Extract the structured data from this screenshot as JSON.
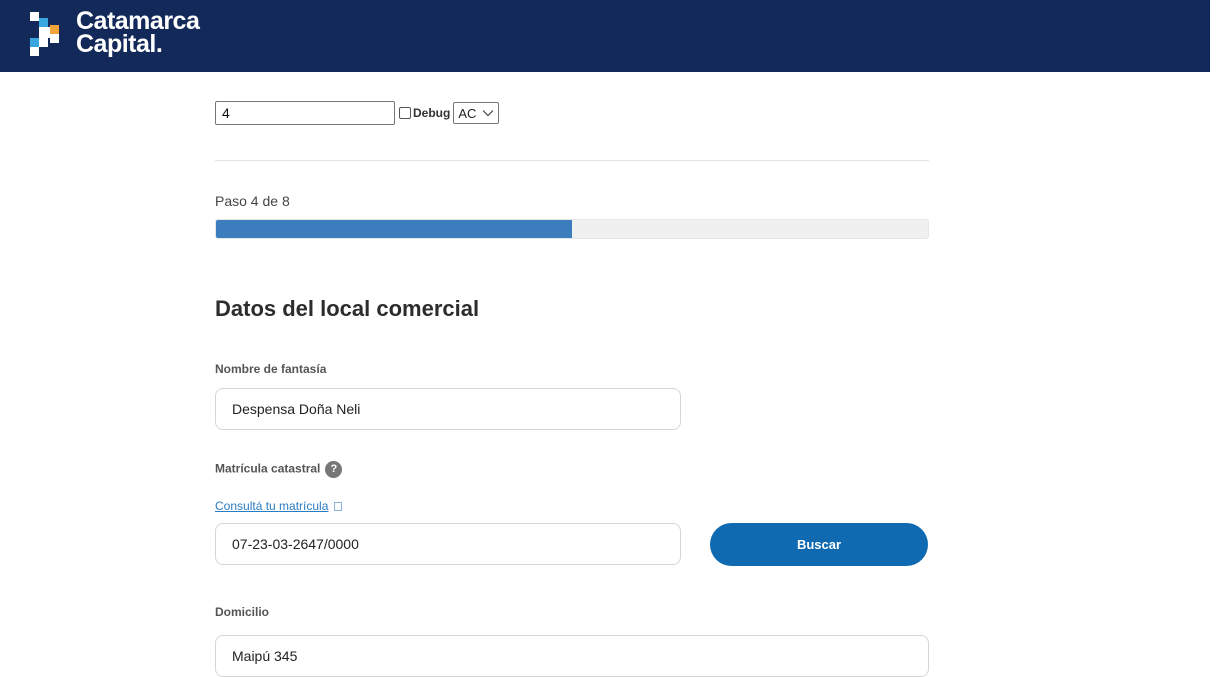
{
  "header": {
    "logo_line1": "Catamarca",
    "logo_line2": "Capital."
  },
  "debug": {
    "input_value": "4",
    "checkbox_label": "Debug",
    "select_value": "AC"
  },
  "progress": {
    "step_text": "Paso 4 de 8",
    "current": 4,
    "total": 8,
    "fill_color": "#3c7dbd"
  },
  "form": {
    "section_title": "Datos del local comercial",
    "fields": {
      "nombre_fantasia": {
        "label": "Nombre de fantasía",
        "value": "Despensa Doña Neli"
      },
      "matricula": {
        "label": "Matrícula catastral",
        "help_icon_glyph": "?",
        "link_text": "Consultá tu matrícula",
        "value": "07-23-03-2647/0000",
        "button_label": "Buscar"
      },
      "domicilio": {
        "label": "Domicilio",
        "value": "Maipú 345"
      }
    }
  },
  "colors": {
    "header_bg": "#13295a",
    "primary_button": "#0f6ab1",
    "link": "#2b7bc0"
  }
}
